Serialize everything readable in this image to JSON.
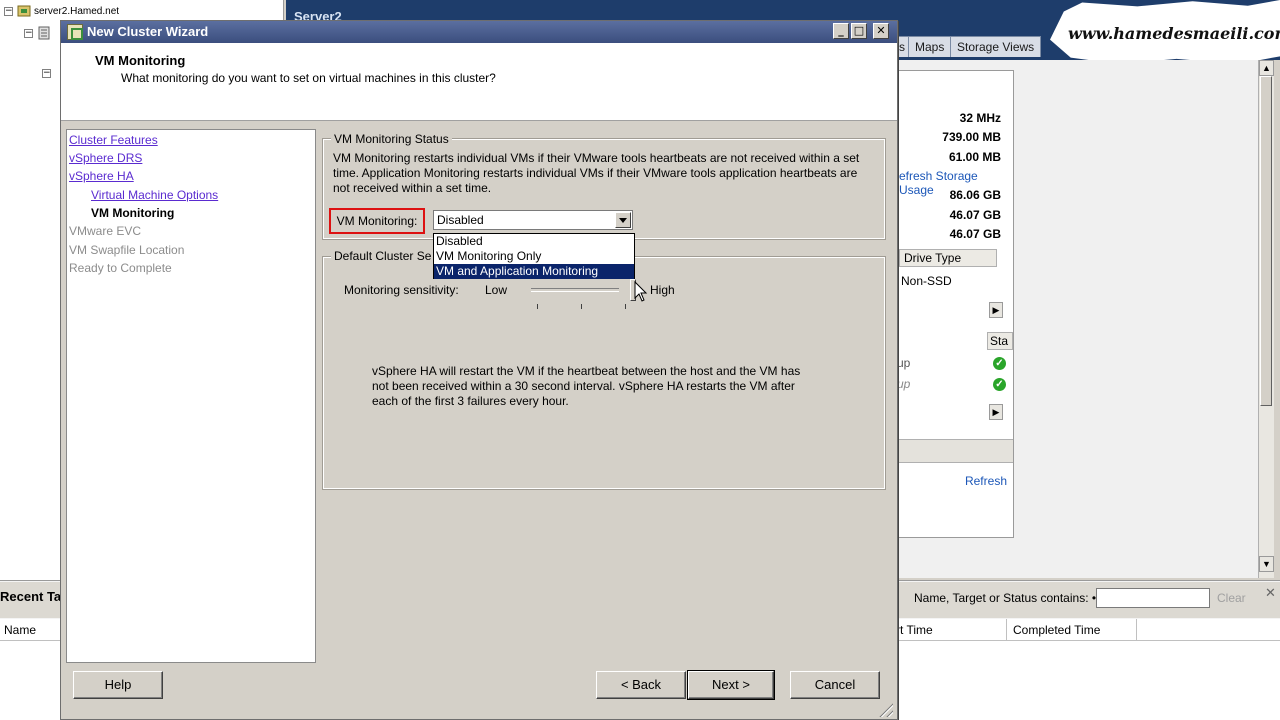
{
  "background": {
    "tree": {
      "root_label": "server2.Hamed.net"
    },
    "header_title": "Server2",
    "tabs": [
      "s",
      "Maps",
      "Storage Views"
    ],
    "watermark": "www.hamedesmaeili.com",
    "resources": {
      "values": [
        "32 MHz",
        "739.00 MB",
        "61.00 MB"
      ],
      "refresh_storage_label": "efresh Storage Usage",
      "storage_values": [
        "86.06 GB",
        "46.07 GB",
        "46.07 GB"
      ],
      "drive_type_header": "Drive Type",
      "drive_type_value": "Non-SSD",
      "status_header": "Sta",
      "network_rows": [
        "up",
        "up"
      ],
      "refresh_label": "Refresh"
    },
    "tasks": {
      "title": "Recent Tas",
      "filter_label": "Name, Target or Status contains: •",
      "filter_value": "",
      "clear_label": "Clear",
      "columns": [
        "Name",
        "rt Time",
        "Completed Time"
      ]
    }
  },
  "wizard": {
    "title": "New Cluster Wizard",
    "page_title": "VM Monitoring",
    "page_subtitle": "What monitoring do you want to set on virtual machines in this cluster?",
    "nav": [
      {
        "label": "Cluster Features",
        "state": "link"
      },
      {
        "label": "vSphere DRS",
        "state": "link"
      },
      {
        "label": "vSphere HA",
        "state": "link"
      },
      {
        "label": "Virtual Machine Options",
        "state": "link"
      },
      {
        "label": "VM Monitoring",
        "state": "current"
      },
      {
        "label": "VMware EVC",
        "state": "disabled"
      },
      {
        "label": "VM Swapfile Location",
        "state": "disabled"
      },
      {
        "label": "Ready to Complete",
        "state": "disabled"
      }
    ],
    "status_group": {
      "title": "VM Monitoring Status",
      "description": "VM Monitoring restarts individual VMs if their VMware tools heartbeats are not received within a set time.  Application Monitoring restarts individual VMs if their VMware tools application heartbeats are not received within a set time.",
      "field_label": "VM Monitoring:",
      "selected": "Disabled",
      "options": [
        "Disabled",
        "VM Monitoring Only",
        "VM and Application Monitoring"
      ],
      "highlighted_option": "VM and Application Monitoring"
    },
    "settings_group": {
      "title": "Default Cluster Se",
      "sensitivity_label": "Monitoring sensitivity:",
      "low_label": "Low",
      "high_label": "High",
      "sensitivity_level": 1.0,
      "info": "vSphere HA will restart the VM if the heartbeat between the host and the VM has not been received within a 30 second interval. vSphere HA restarts the VM after each of the first 3 failures every hour."
    },
    "buttons": {
      "help": "Help",
      "back": "< Back",
      "next": "Next >",
      "cancel": "Cancel"
    }
  }
}
